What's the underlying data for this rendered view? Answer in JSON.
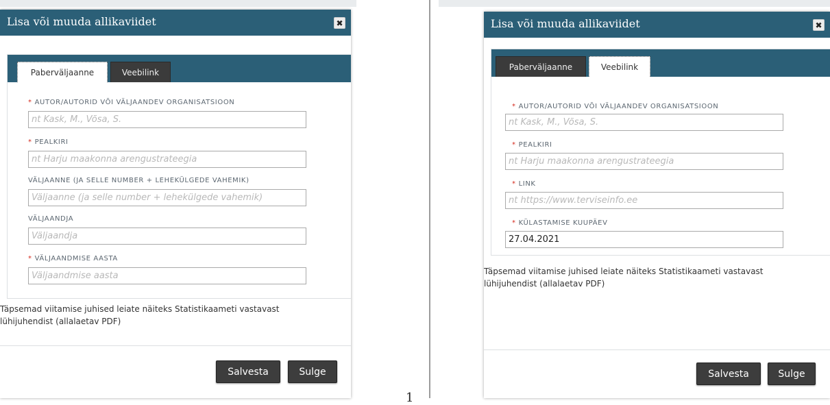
{
  "left_dialog": {
    "title": "Lisa või muuda allikaviidet",
    "close_glyph": "✖",
    "tabs": [
      {
        "label": "Paberväljaanne",
        "active": true
      },
      {
        "label": "Veebilink",
        "active": false
      }
    ],
    "fields": [
      {
        "label": "AUTOR/AUTORID VÕI VÄLJAANDEV ORGANISATSIOON",
        "required": true,
        "placeholder": "nt Kask, M., Võsa, S.",
        "value": ""
      },
      {
        "label": "PEALKIRI",
        "required": true,
        "placeholder": "nt Harju maakonna arengustrateegia",
        "value": ""
      },
      {
        "label": "VÄLJAANNE (JA SELLE NUMBER + LEHEKÜLGEDE VAHEMIK)",
        "required": false,
        "placeholder": "Väljaanne (ja selle number + lehekülgede vahemik)",
        "value": ""
      },
      {
        "label": "VÄLJAANDJA",
        "required": false,
        "placeholder": "Väljaandja",
        "value": ""
      },
      {
        "label": "VÄLJAANDMISE AASTA",
        "required": true,
        "placeholder": "Väljaandmise aasta",
        "value": ""
      }
    ],
    "footnote": "Täpsemad viitamise juhised leiate näiteks Statistikaameti vastavast lühijuhendist (allalaetav PDF)",
    "buttons": {
      "save": "Salvesta",
      "close": "Sulge"
    }
  },
  "right_dialog": {
    "title": "Lisa või muuda allikaviidet",
    "close_glyph": "✖",
    "tabs": [
      {
        "label": "Paberväljaanne",
        "active": false
      },
      {
        "label": "Veebilink",
        "active": true
      }
    ],
    "fields": [
      {
        "label": "AUTOR/AUTORID VÕI VÄLJAANDEV ORGANISATSIOON",
        "required": true,
        "placeholder": "nt Kask, M., Võsa, S.",
        "value": ""
      },
      {
        "label": "PEALKIRI",
        "required": true,
        "placeholder": "nt Harju maakonna arengustrateegia",
        "value": ""
      },
      {
        "label": "LINK",
        "required": true,
        "placeholder": "nt https://www.terviseinfo.ee",
        "value": ""
      },
      {
        "label": "KÜLASTAMISE KUUPÄEV",
        "required": true,
        "placeholder": "",
        "value": "27.04.2021"
      }
    ],
    "footnote": "Täpsemad viitamise juhised leiate näiteks Statistikaameti vastavast lühijuhendist (allalaetav PDF)",
    "buttons": {
      "save": "Salvesta",
      "close": "Sulge"
    }
  },
  "required_marker": "*",
  "stray_char": "1",
  "colors": {
    "titlebar": "#2b5f77",
    "tabbar": "#2b5f77",
    "button": "#3d3d3d",
    "required": "#d52b1e"
  }
}
